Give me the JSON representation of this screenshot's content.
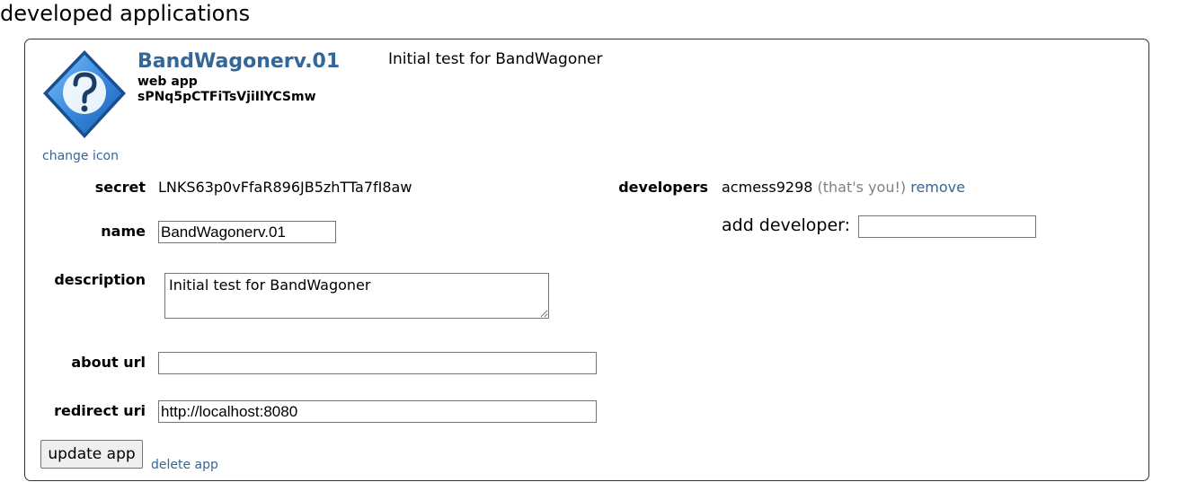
{
  "page": {
    "heading": "developed applications"
  },
  "app": {
    "name": "BandWagonerv.01",
    "type": "web app",
    "client_id": "sPNq5pCTFiTsVjiIlYCSmw",
    "description_header": "Initial test for BandWagoner",
    "change_icon_label": "change icon",
    "icon": "question-mark-icon"
  },
  "fields": {
    "secret_label": "secret",
    "secret_value": "LNKS63p0vFfaR896JB5zhTTa7fI8aw",
    "name_label": "name",
    "name_value": "BandWagonerv.01",
    "description_label": "description",
    "description_value": "Initial test for BandWagoner",
    "about_label": "about url",
    "about_value": "",
    "redirect_label": "redirect uri",
    "redirect_value": "http://localhost:8080"
  },
  "developers": {
    "label": "developers",
    "name": "acmess9298",
    "you_note": "(that's you!)",
    "remove_label": "remove",
    "add_label": "add developer:",
    "add_value": ""
  },
  "actions": {
    "update_label": "update app",
    "delete_label": "delete app"
  },
  "colors": {
    "link": "#336699",
    "icon_blue": "#2f7fd8"
  }
}
